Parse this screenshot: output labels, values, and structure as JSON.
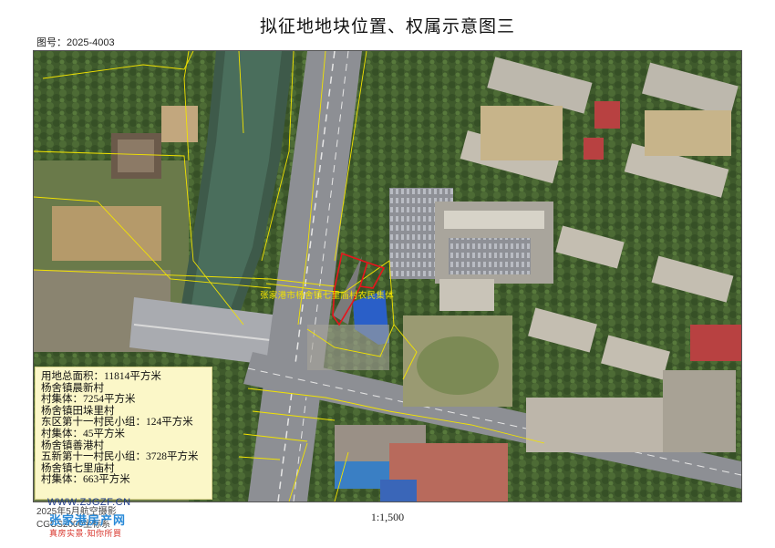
{
  "header": {
    "title": "拟征地地块位置、权属示意图三",
    "map_number": "图号：2025-4003"
  },
  "parcel": {
    "label": "张家港市杨舍镇七里庙村农民集体",
    "boundary_color": "#e8141c",
    "label_color": "#f2e300"
  },
  "info_box": {
    "lines": [
      "用地总面积：11814平方米",
      "杨舍镇晨新村",
      "村集体：7254平方米",
      "杨舍镇田垛里村",
      "东区第十一村民小组：124平方米",
      "村集体：45平方米",
      "杨舍镇善港村",
      "五新第十一村民小组：3728平方米",
      "杨舍镇七里庙村",
      "村集体：663平方米"
    ]
  },
  "footer": {
    "scale": "1:1,500",
    "date": "2025年5月航空摄影",
    "crs": "CGCS2000坐标系"
  },
  "watermark": {
    "url": "WWW.ZJGZF.CN",
    "name": "张家港房产网",
    "slogan": "真房实景·知你所買"
  }
}
